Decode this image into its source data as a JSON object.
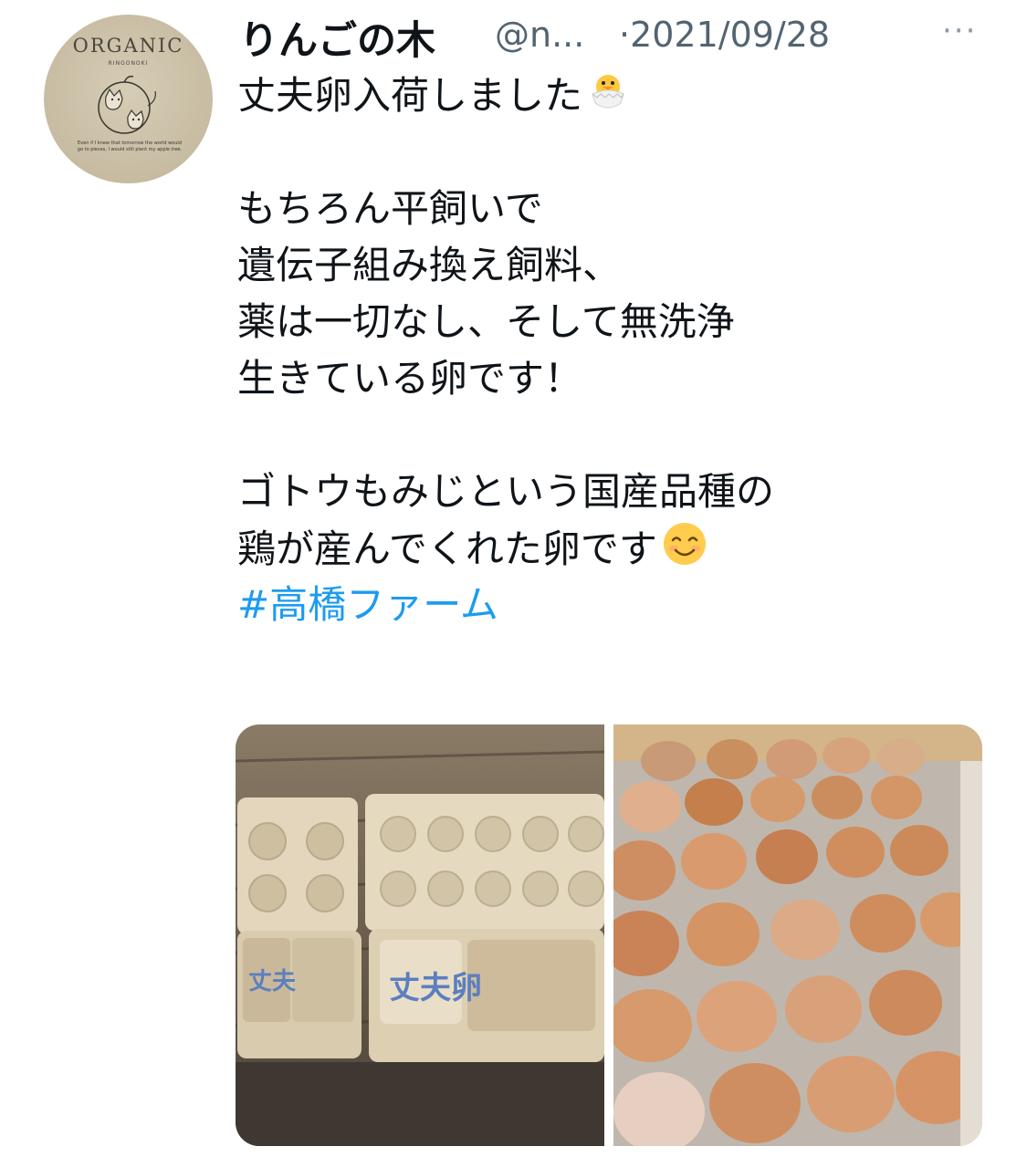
{
  "tweet": {
    "author_name": "りんごの木",
    "handle": "@n...",
    "date": "·2021/09/28",
    "more_label": "···",
    "avatar": {
      "title": "ORGANIC",
      "subtitle": "RINGONOKI",
      "motto": "Even if I knew that tomorrow the world would go to pieces, I would still plant my apple tree."
    },
    "text_lines": [
      "丈夫卵入荷しました",
      "",
      "もちろん平飼いで",
      "遺伝子組み換え飼料、",
      "薬は一切なし、そして無洗浄",
      "生きている卵です！",
      "",
      "ゴトウもみじという国産品種の",
      "鶏が産んでくれた卵です"
    ],
    "emoji_1": "hatching-chick-emoji",
    "emoji_2": "smiling-face-emoji",
    "hashtag": "#高橋ファーム",
    "media": [
      {
        "name": "egg-cartons-photo",
        "label_text": "丈夫卵"
      },
      {
        "name": "egg-tray-photo"
      }
    ]
  },
  "colors": {
    "text": "#0f1419",
    "secondary": "#536471",
    "link": "#1d9bf0"
  }
}
